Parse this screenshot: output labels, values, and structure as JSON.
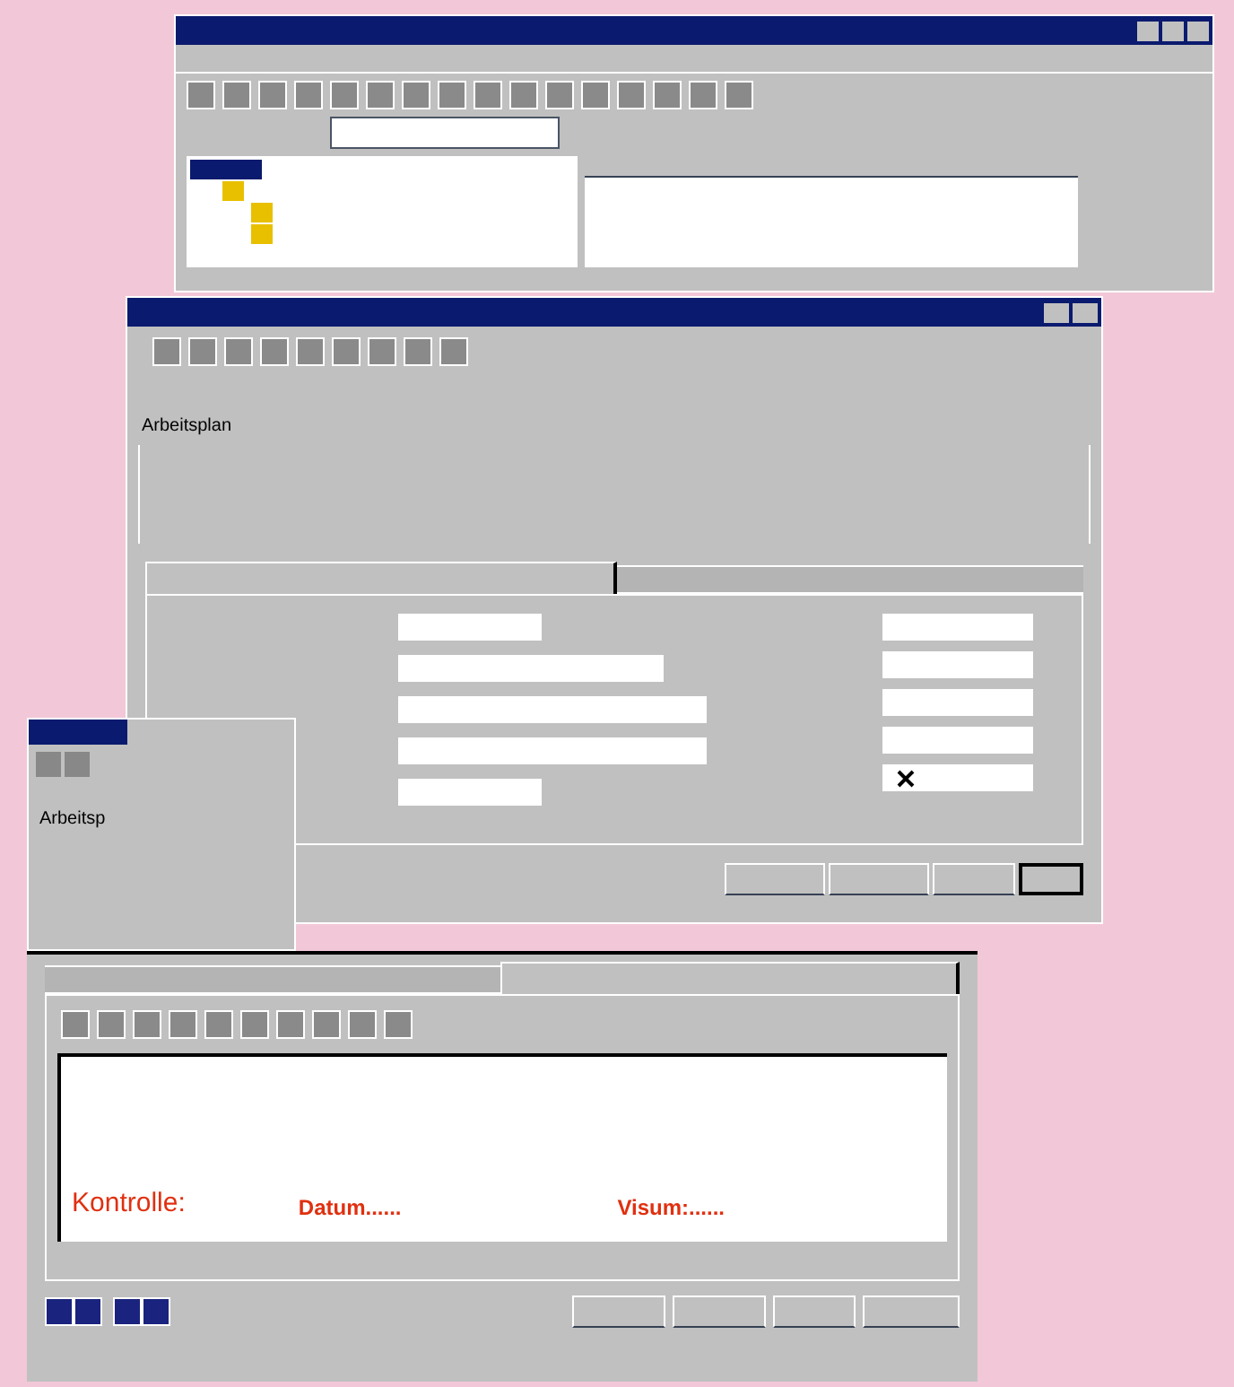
{
  "main_window": {
    "tree": [
      {
        "selected": true
      },
      {
        "selected": false
      },
      {
        "selected": false
      },
      {
        "selected": false
      }
    ]
  },
  "detail_window": {
    "header": "Arbeitsplan",
    "tabs": [
      {
        "selected": true
      },
      {
        "selected": false
      }
    ],
    "checkbox": {
      "checked": true
    }
  },
  "small_window": {
    "header": "Arbeitsp"
  },
  "info_panel": {
    "tabs": [
      {
        "selected": false
      },
      {
        "selected": true
      }
    ],
    "control_row": [
      {
        "kind": "label",
        "text": "Kontrolle:"
      },
      {
        "kind": "field",
        "text": "Datum......"
      },
      {
        "kind": "field",
        "text": "Visum:......"
      }
    ]
  }
}
